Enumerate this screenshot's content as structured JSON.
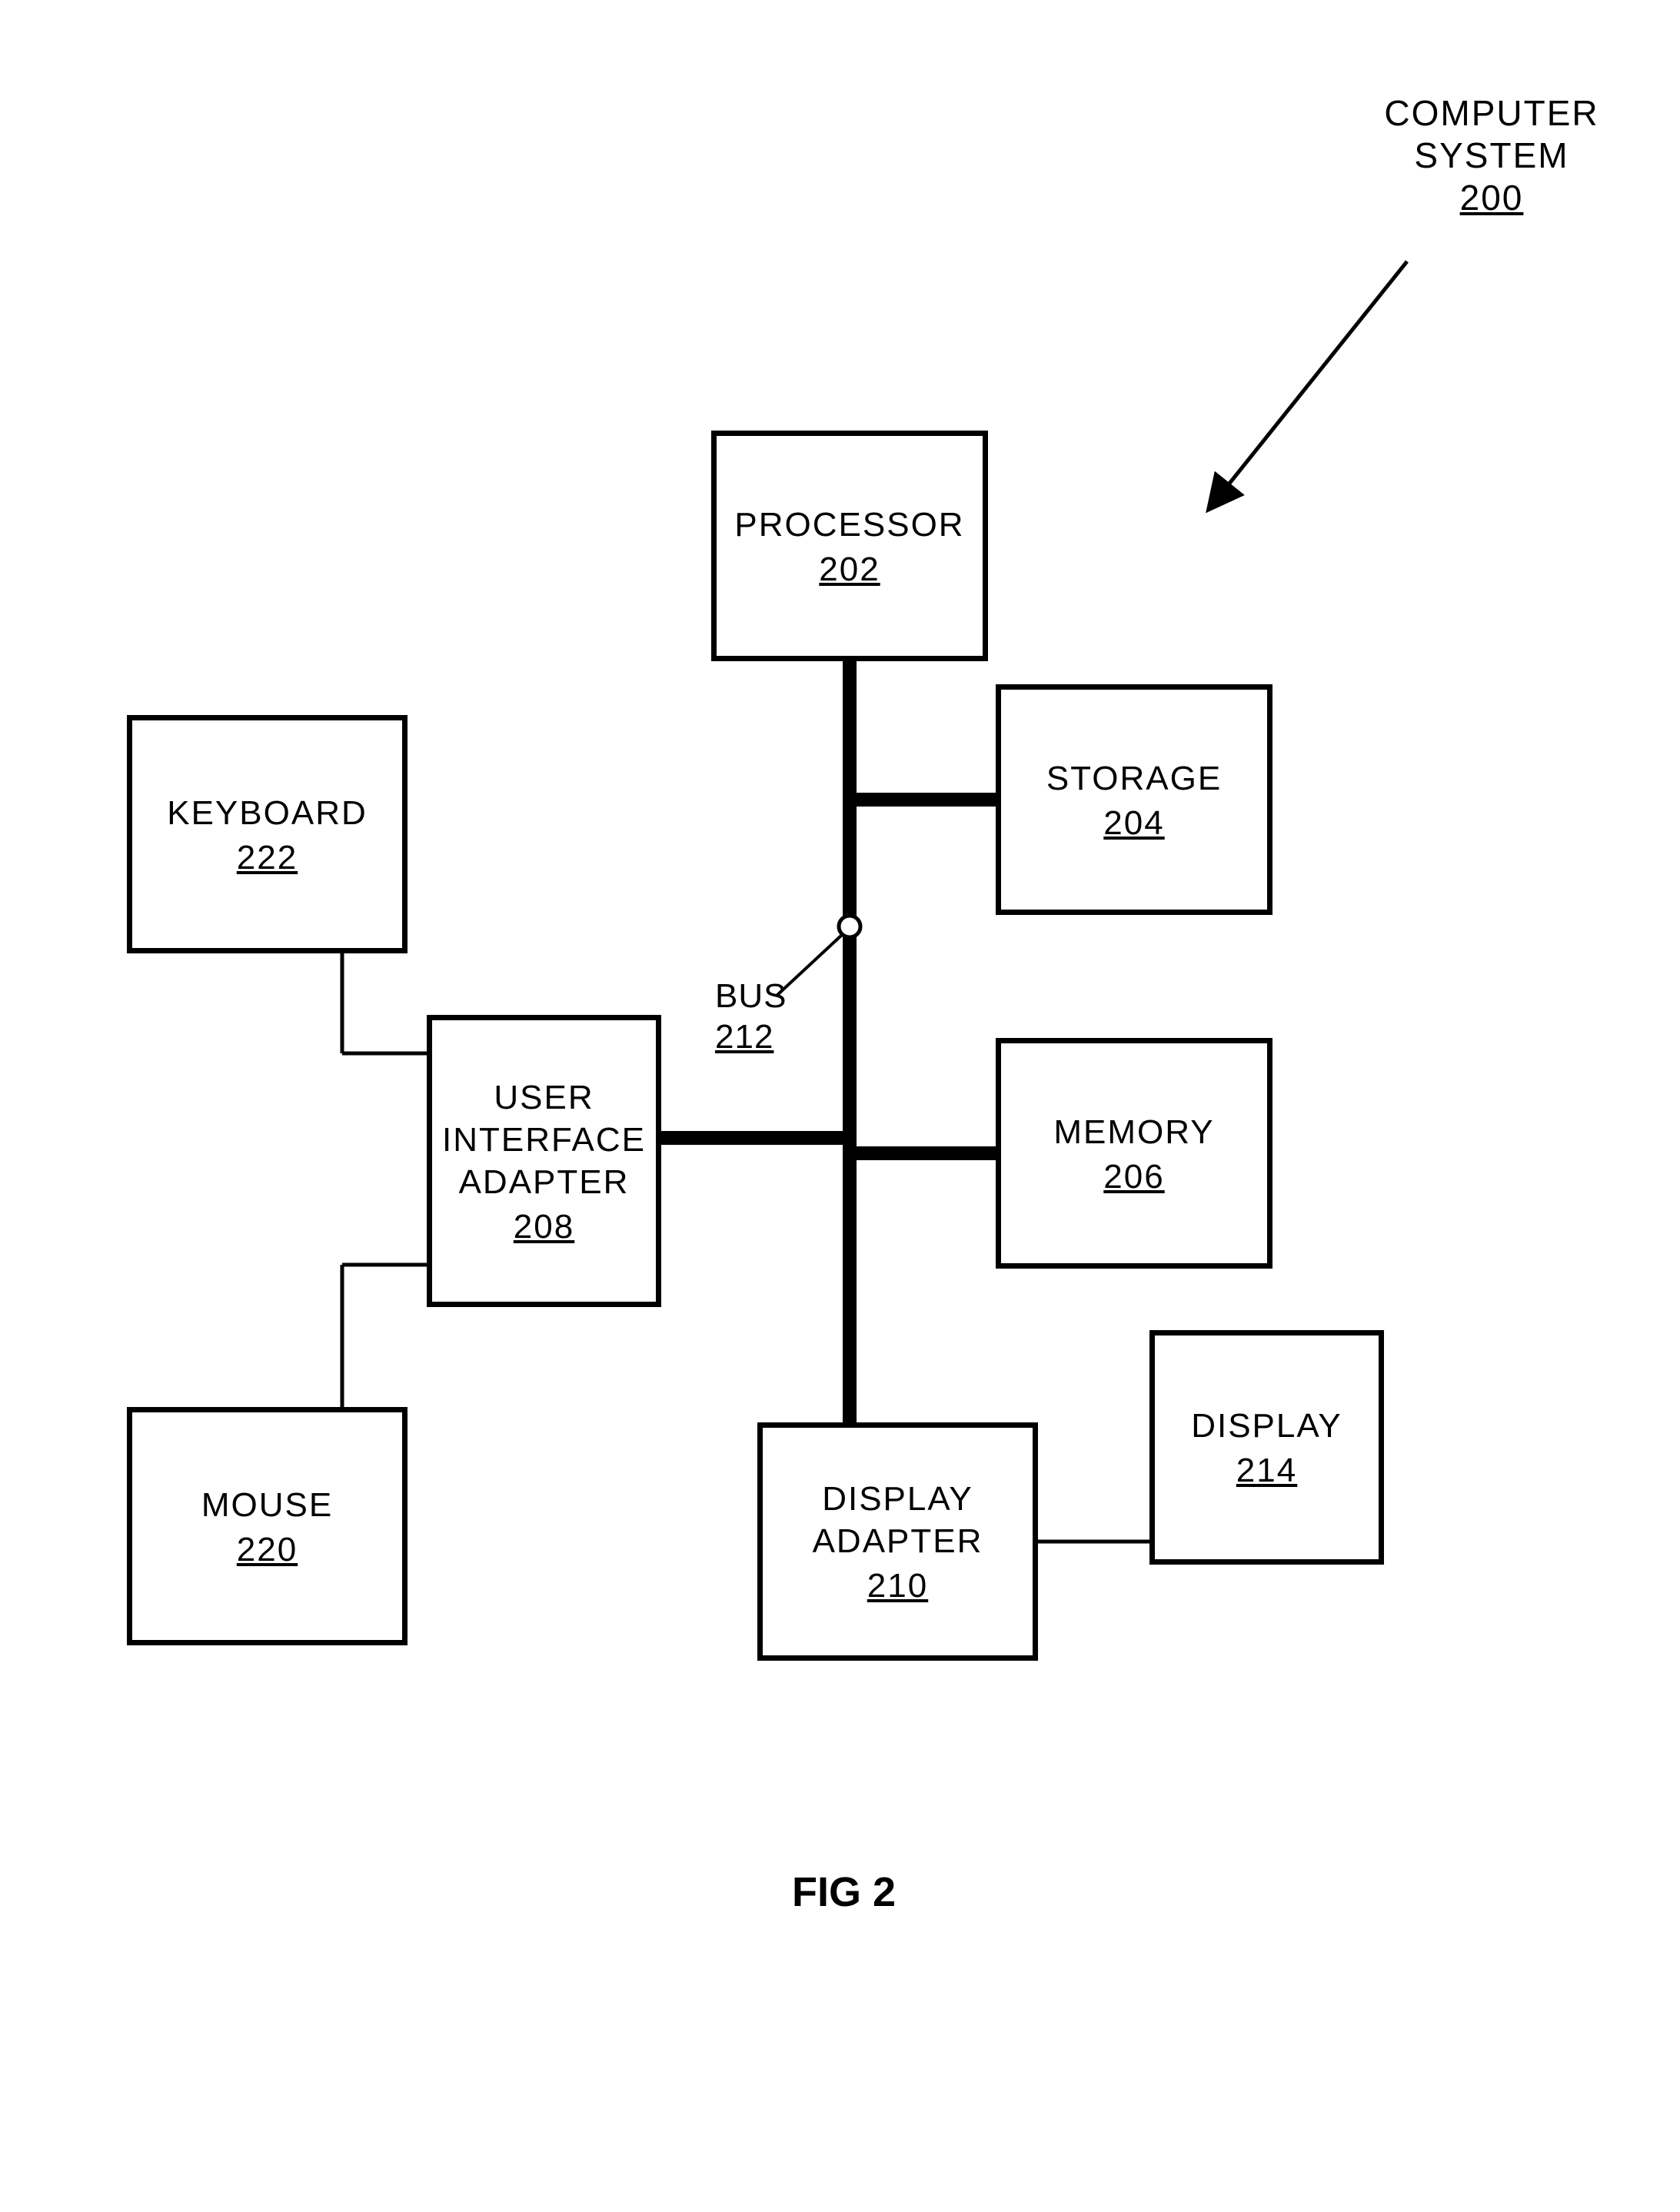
{
  "title": {
    "label": "COMPUTER\nSYSTEM",
    "ref": "200"
  },
  "figure": "FIG 2",
  "bus": {
    "label": "BUS",
    "ref": "212"
  },
  "boxes": {
    "processor": {
      "label": "PROCESSOR",
      "ref": "202"
    },
    "storage": {
      "label": "STORAGE",
      "ref": "204"
    },
    "memory": {
      "label": "MEMORY",
      "ref": "206"
    },
    "uiAdapter": {
      "label": "USER\nINTERFACE\nADAPTER",
      "ref": "208"
    },
    "displayAdapter": {
      "label": "DISPLAY\nADAPTER",
      "ref": "210"
    },
    "display": {
      "label": "DISPLAY",
      "ref": "214"
    },
    "mouse": {
      "label": "MOUSE",
      "ref": "220"
    },
    "keyboard": {
      "label": "KEYBOARD",
      "ref": "222"
    }
  }
}
